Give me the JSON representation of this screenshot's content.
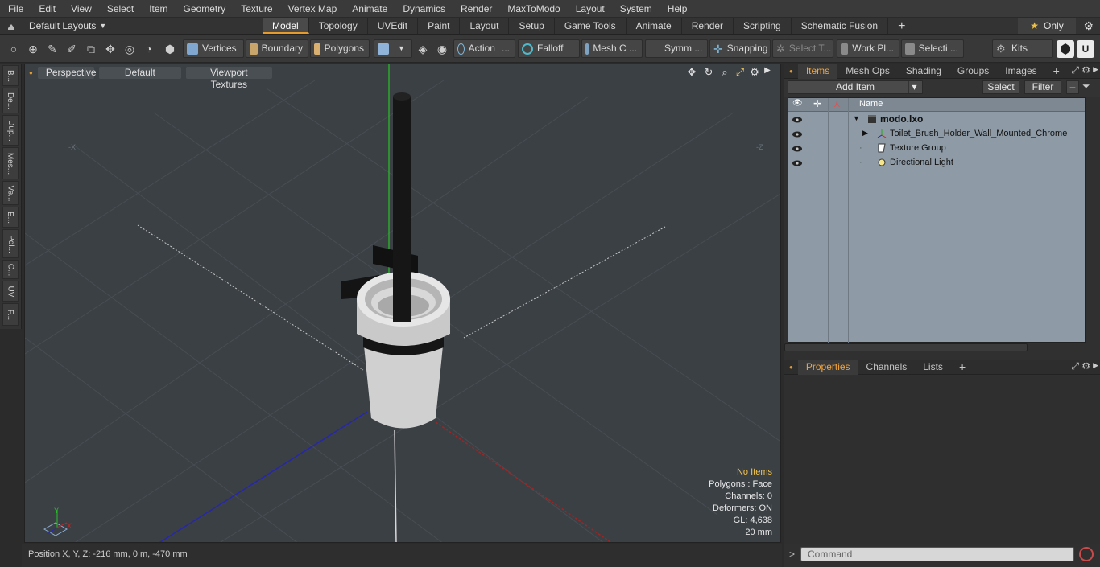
{
  "menu": [
    "File",
    "Edit",
    "View",
    "Select",
    "Item",
    "Geometry",
    "Texture",
    "Vertex Map",
    "Animate",
    "Dynamics",
    "Render",
    "MaxToModo",
    "Layout",
    "System",
    "Help"
  ],
  "layout": {
    "selector": "Default Layouts"
  },
  "tabs": [
    "Model",
    "Topology",
    "UVEdit",
    "Paint",
    "Layout",
    "Setup",
    "Game Tools",
    "Animate",
    "Render",
    "Scripting",
    "Schematic Fusion"
  ],
  "active_tab": "Model",
  "only_label": "Only",
  "toolbar": {
    "vertices": "Vertices",
    "boundary": "Boundary",
    "polygons": "Polygons",
    "action": "Action",
    "falloff": "Falloff",
    "mesh": "Mesh C ...",
    "symm": "Symm ...",
    "snapping": "Snapping",
    "select_t": "Select T...",
    "work_pl": "Work Pl...",
    "selecti": "Selecti ...",
    "kits": "Kits"
  },
  "left_tabs": [
    "B...",
    "De...",
    "Dup...",
    "Mes...",
    "Ve...",
    "E...",
    "Pol...",
    "C...",
    "UV",
    "F..."
  ],
  "viewport": {
    "view": "Perspective",
    "shading": "Default",
    "textures": "Viewport Textures",
    "info": {
      "selection": "No Items",
      "polygons": "Polygons : Face",
      "channels": "Channels: 0",
      "deformers": "Deformers: ON",
      "gl": "GL: 4,638",
      "grid": "20 mm"
    },
    "axis_labels": {
      "x": "X",
      "y": "Y",
      "nx": "-X",
      "nz": "-Z"
    }
  },
  "status": {
    "position": "Position X, Y, Z:  -216 mm, 0 m, -470 mm"
  },
  "items_panel": {
    "tabs": [
      "Items",
      "Mesh Ops",
      "Shading",
      "Groups",
      "Images"
    ],
    "active": "Items",
    "add_item": "Add Item",
    "select": "Select",
    "filter": "Filter",
    "column_name": "Name",
    "rows": [
      {
        "label": "modo.lxo",
        "bold": true
      },
      {
        "label": "Toilet_Brush_Holder_Wall_Mounted_Chrome"
      },
      {
        "label": "Texture Group"
      },
      {
        "label": "Directional Light"
      }
    ]
  },
  "properties_panel": {
    "tabs": [
      "Properties",
      "Channels",
      "Lists"
    ],
    "active": "Properties"
  },
  "command": {
    "placeholder": "Command",
    "prompt": ">"
  },
  "colors": {
    "accent": "#e59a2b",
    "list_bg": "#8e9aa5",
    "viewport_bg": "#3b4045"
  }
}
